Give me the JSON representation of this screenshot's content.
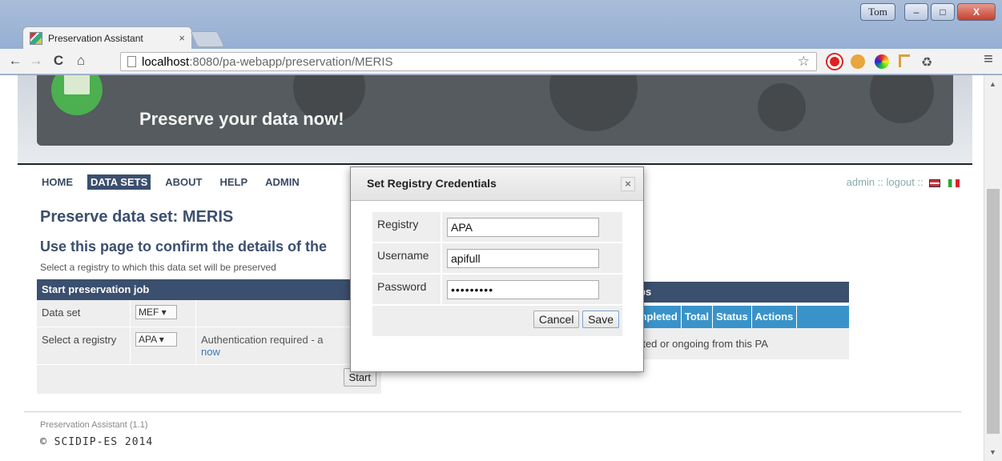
{
  "browser": {
    "tab_title": "Preservation Assistant",
    "tab_close": "×",
    "user_badge": "Tom",
    "url_host": "localhost",
    "url_path": ":8080/pa-webapp/preservation/MERIS",
    "back": "←",
    "forward": "→",
    "reload": "C",
    "home": "⌂",
    "star": "☆",
    "menu": "≡",
    "min": "–",
    "max": "□",
    "close": "X"
  },
  "header": {
    "tagline": "Preserve your data now!"
  },
  "nav": {
    "items": [
      "HOME",
      "DATA SETS",
      "ABOUT",
      "HELP",
      "ADMIN"
    ],
    "active": "DATA SETS"
  },
  "user_links": {
    "text": "admin :: logout ::"
  },
  "main": {
    "title": "Preserve data set: MERIS",
    "subtitle": "Use this page to confirm the details of the",
    "instruction": "Select a registry to which this data set will be preserved"
  },
  "job_panel": {
    "heading": "Start preservation job",
    "dataset_label": "Data set",
    "dataset_value": "MEF ▾",
    "registry_label": "Select a registry",
    "registry_value": "APA ▾",
    "auth_text": "Authentication required - a",
    "auth_link": "now",
    "start_label": "Start"
  },
  "jobs_panel": {
    "heading": "bs",
    "columns": [
      "mpleted",
      "Total",
      "Status",
      "Actions"
    ],
    "empty_text": "rted or ongoing from this PA"
  },
  "footer": {
    "version": "Preservation Assistant (1.1)",
    "copyright": "© SCIDIP-ES 2014"
  },
  "modal": {
    "title": "Set Registry Credentials",
    "close": "×",
    "registry_label": "Registry",
    "registry_value": "APA",
    "username_label": "Username",
    "username_value": "apifull",
    "password_label": "Password",
    "password_value": "•••••••••",
    "cancel_label": "Cancel",
    "save_label": "Save"
  },
  "colors": {
    "nav_active": "#3b4f6e",
    "table_header": "#3b4f6e",
    "jobs_columns": "#3993c9",
    "logo_green": "#4caf50"
  }
}
